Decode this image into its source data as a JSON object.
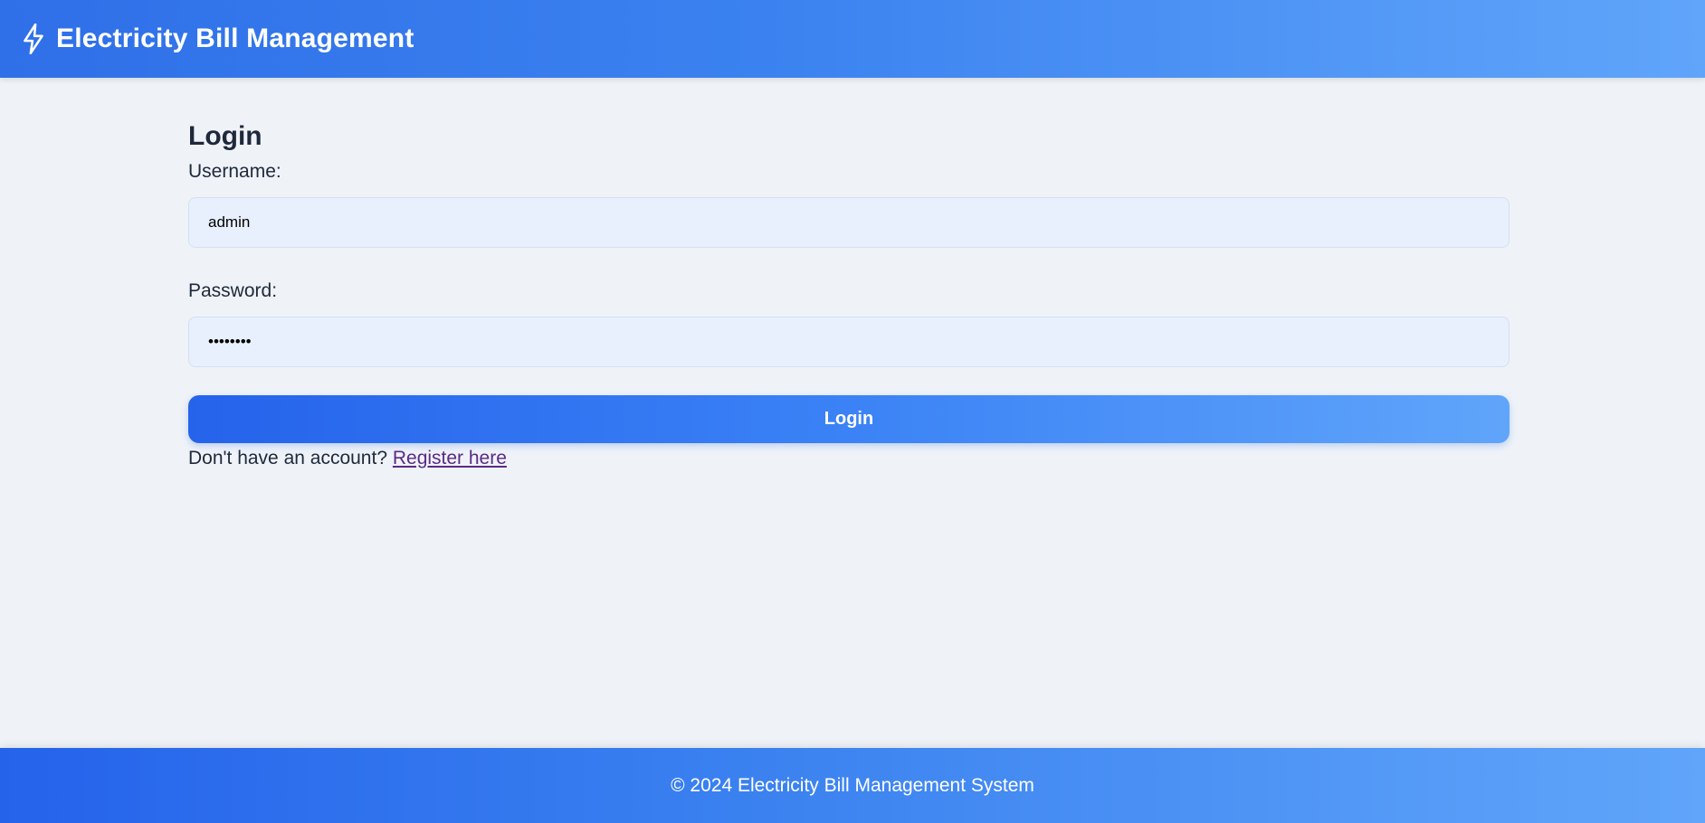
{
  "header": {
    "icon": "lightning-bolt-icon",
    "title": "Electricity Bill Management"
  },
  "login_form": {
    "heading": "Login",
    "username_label": "Username:",
    "username_value": "admin",
    "password_label": "Password:",
    "password_value": "password",
    "submit_label": "Login",
    "register_prompt": "Don't have an account?",
    "register_link": "Register here"
  },
  "footer": {
    "text": "© 2024 Electricity Bill Management System"
  },
  "colors": {
    "header_gradient_start": "#2f6fe8",
    "header_gradient_end": "#60a5fa",
    "page_background": "#eff3f8",
    "input_background": "#e8f0fe",
    "link_color": "#5b2a86"
  }
}
